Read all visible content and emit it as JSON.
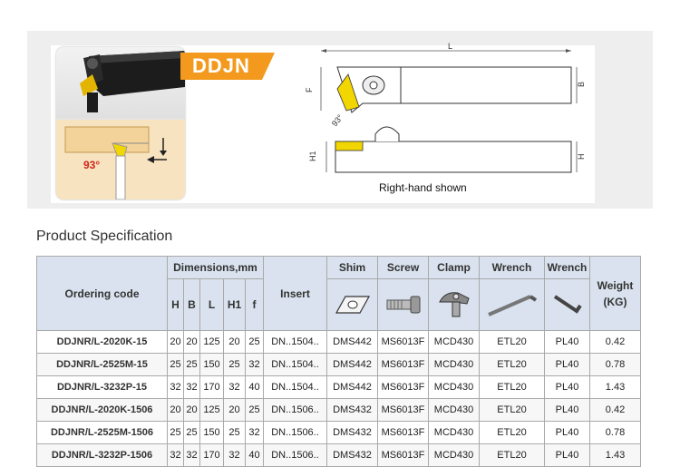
{
  "banner": {
    "title": "DDJN",
    "angle_label": "93°",
    "drawing_labels": {
      "L": "L",
      "F": "F",
      "B": "B",
      "angle": "93°",
      "H1": "H1",
      "H": "H"
    },
    "caption": "Right-hand shown"
  },
  "section_title": "Product Specification",
  "table": {
    "headers": {
      "ordering_code": "Ordering code",
      "dimensions": "Dimensions,mm",
      "dims": [
        "H",
        "B",
        "L",
        "H1",
        "f"
      ],
      "insert": "Insert",
      "shim": "Shim",
      "screw": "Screw",
      "clamp": "Clamp",
      "wrench1": "Wrench",
      "wrench2": "Wrench",
      "weight": "Weight\n(KG)"
    },
    "rows": [
      {
        "code": "DDJNR/L-2020K-15",
        "H": "20",
        "B": "20",
        "L": "125",
        "H1": "20",
        "f": "25",
        "insert": "DN..1504..",
        "shim": "DMS442",
        "screw": "MS6013F",
        "clamp": "MCD430",
        "wrench1": "ETL20",
        "wrench2": "PL40",
        "weight": "0.42"
      },
      {
        "code": "DDJNR/L-2525M-15",
        "H": "25",
        "B": "25",
        "L": "150",
        "H1": "25",
        "f": "32",
        "insert": "DN..1504..",
        "shim": "DMS442",
        "screw": "MS6013F",
        "clamp": "MCD430",
        "wrench1": "ETL20",
        "wrench2": "PL40",
        "weight": "0.78"
      },
      {
        "code": "DDJNR/L-3232P-15",
        "H": "32",
        "B": "32",
        "L": "170",
        "H1": "32",
        "f": "40",
        "insert": "DN..1504..",
        "shim": "DMS442",
        "screw": "MS6013F",
        "clamp": "MCD430",
        "wrench1": "ETL20",
        "wrench2": "PL40",
        "weight": "1.43"
      },
      {
        "code": "DDJNR/L-2020K-1506",
        "H": "20",
        "B": "20",
        "L": "125",
        "H1": "20",
        "f": "25",
        "insert": "DN..1506..",
        "shim": "DMS432",
        "screw": "MS6013F",
        "clamp": "MCD430",
        "wrench1": "ETL20",
        "wrench2": "PL40",
        "weight": "0.42"
      },
      {
        "code": "DDJNR/L-2525M-1506",
        "H": "25",
        "B": "25",
        "L": "150",
        "H1": "25",
        "f": "32",
        "insert": "DN..1506..",
        "shim": "DMS432",
        "screw": "MS6013F",
        "clamp": "MCD430",
        "wrench1": "ETL20",
        "wrench2": "PL40",
        "weight": "0.78"
      },
      {
        "code": "DDJNR/L-3232P-1506",
        "H": "32",
        "B": "32",
        "L": "170",
        "H1": "32",
        "f": "40",
        "insert": "DN..1506..",
        "shim": "DMS432",
        "screw": "MS6013F",
        "clamp": "MCD430",
        "wrench1": "ETL20",
        "wrench2": "PL40",
        "weight": "1.43"
      }
    ]
  },
  "colors": {
    "title_tag": "#f39a1e",
    "header_bg": "#d9e2ee",
    "insert_yellow": "#f2d600"
  },
  "icons": [
    "shim-icon",
    "screw-icon",
    "clamp-icon",
    "torx-wrench-icon",
    "hex-wrench-icon"
  ]
}
